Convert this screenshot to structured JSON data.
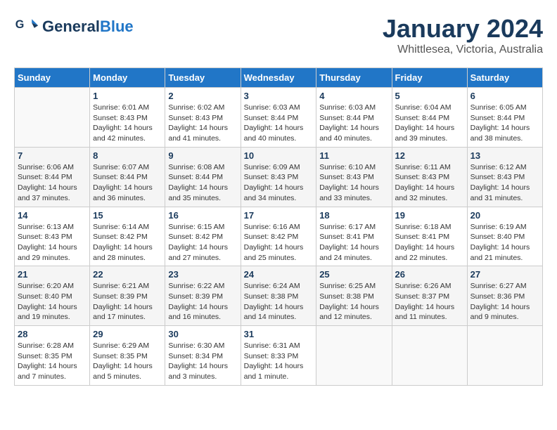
{
  "header": {
    "logo_line1": "General",
    "logo_line2": "Blue",
    "month": "January 2024",
    "location": "Whittlesea, Victoria, Australia"
  },
  "days_of_week": [
    "Sunday",
    "Monday",
    "Tuesday",
    "Wednesday",
    "Thursday",
    "Friday",
    "Saturday"
  ],
  "weeks": [
    [
      {
        "day": "",
        "info": ""
      },
      {
        "day": "1",
        "info": "Sunrise: 6:01 AM\nSunset: 8:43 PM\nDaylight: 14 hours\nand 42 minutes."
      },
      {
        "day": "2",
        "info": "Sunrise: 6:02 AM\nSunset: 8:43 PM\nDaylight: 14 hours\nand 41 minutes."
      },
      {
        "day": "3",
        "info": "Sunrise: 6:03 AM\nSunset: 8:44 PM\nDaylight: 14 hours\nand 40 minutes."
      },
      {
        "day": "4",
        "info": "Sunrise: 6:03 AM\nSunset: 8:44 PM\nDaylight: 14 hours\nand 40 minutes."
      },
      {
        "day": "5",
        "info": "Sunrise: 6:04 AM\nSunset: 8:44 PM\nDaylight: 14 hours\nand 39 minutes."
      },
      {
        "day": "6",
        "info": "Sunrise: 6:05 AM\nSunset: 8:44 PM\nDaylight: 14 hours\nand 38 minutes."
      }
    ],
    [
      {
        "day": "7",
        "info": "Sunrise: 6:06 AM\nSunset: 8:44 PM\nDaylight: 14 hours\nand 37 minutes."
      },
      {
        "day": "8",
        "info": "Sunrise: 6:07 AM\nSunset: 8:44 PM\nDaylight: 14 hours\nand 36 minutes."
      },
      {
        "day": "9",
        "info": "Sunrise: 6:08 AM\nSunset: 8:44 PM\nDaylight: 14 hours\nand 35 minutes."
      },
      {
        "day": "10",
        "info": "Sunrise: 6:09 AM\nSunset: 8:43 PM\nDaylight: 14 hours\nand 34 minutes."
      },
      {
        "day": "11",
        "info": "Sunrise: 6:10 AM\nSunset: 8:43 PM\nDaylight: 14 hours\nand 33 minutes."
      },
      {
        "day": "12",
        "info": "Sunrise: 6:11 AM\nSunset: 8:43 PM\nDaylight: 14 hours\nand 32 minutes."
      },
      {
        "day": "13",
        "info": "Sunrise: 6:12 AM\nSunset: 8:43 PM\nDaylight: 14 hours\nand 31 minutes."
      }
    ],
    [
      {
        "day": "14",
        "info": "Sunrise: 6:13 AM\nSunset: 8:43 PM\nDaylight: 14 hours\nand 29 minutes."
      },
      {
        "day": "15",
        "info": "Sunrise: 6:14 AM\nSunset: 8:42 PM\nDaylight: 14 hours\nand 28 minutes."
      },
      {
        "day": "16",
        "info": "Sunrise: 6:15 AM\nSunset: 8:42 PM\nDaylight: 14 hours\nand 27 minutes."
      },
      {
        "day": "17",
        "info": "Sunrise: 6:16 AM\nSunset: 8:42 PM\nDaylight: 14 hours\nand 25 minutes."
      },
      {
        "day": "18",
        "info": "Sunrise: 6:17 AM\nSunset: 8:41 PM\nDaylight: 14 hours\nand 24 minutes."
      },
      {
        "day": "19",
        "info": "Sunrise: 6:18 AM\nSunset: 8:41 PM\nDaylight: 14 hours\nand 22 minutes."
      },
      {
        "day": "20",
        "info": "Sunrise: 6:19 AM\nSunset: 8:40 PM\nDaylight: 14 hours\nand 21 minutes."
      }
    ],
    [
      {
        "day": "21",
        "info": "Sunrise: 6:20 AM\nSunset: 8:40 PM\nDaylight: 14 hours\nand 19 minutes."
      },
      {
        "day": "22",
        "info": "Sunrise: 6:21 AM\nSunset: 8:39 PM\nDaylight: 14 hours\nand 17 minutes."
      },
      {
        "day": "23",
        "info": "Sunrise: 6:22 AM\nSunset: 8:39 PM\nDaylight: 14 hours\nand 16 minutes."
      },
      {
        "day": "24",
        "info": "Sunrise: 6:24 AM\nSunset: 8:38 PM\nDaylight: 14 hours\nand 14 minutes."
      },
      {
        "day": "25",
        "info": "Sunrise: 6:25 AM\nSunset: 8:38 PM\nDaylight: 14 hours\nand 12 minutes."
      },
      {
        "day": "26",
        "info": "Sunrise: 6:26 AM\nSunset: 8:37 PM\nDaylight: 14 hours\nand 11 minutes."
      },
      {
        "day": "27",
        "info": "Sunrise: 6:27 AM\nSunset: 8:36 PM\nDaylight: 14 hours\nand 9 minutes."
      }
    ],
    [
      {
        "day": "28",
        "info": "Sunrise: 6:28 AM\nSunset: 8:35 PM\nDaylight: 14 hours\nand 7 minutes."
      },
      {
        "day": "29",
        "info": "Sunrise: 6:29 AM\nSunset: 8:35 PM\nDaylight: 14 hours\nand 5 minutes."
      },
      {
        "day": "30",
        "info": "Sunrise: 6:30 AM\nSunset: 8:34 PM\nDaylight: 14 hours\nand 3 minutes."
      },
      {
        "day": "31",
        "info": "Sunrise: 6:31 AM\nSunset: 8:33 PM\nDaylight: 14 hours\nand 1 minute."
      },
      {
        "day": "",
        "info": ""
      },
      {
        "day": "",
        "info": ""
      },
      {
        "day": "",
        "info": ""
      }
    ]
  ]
}
